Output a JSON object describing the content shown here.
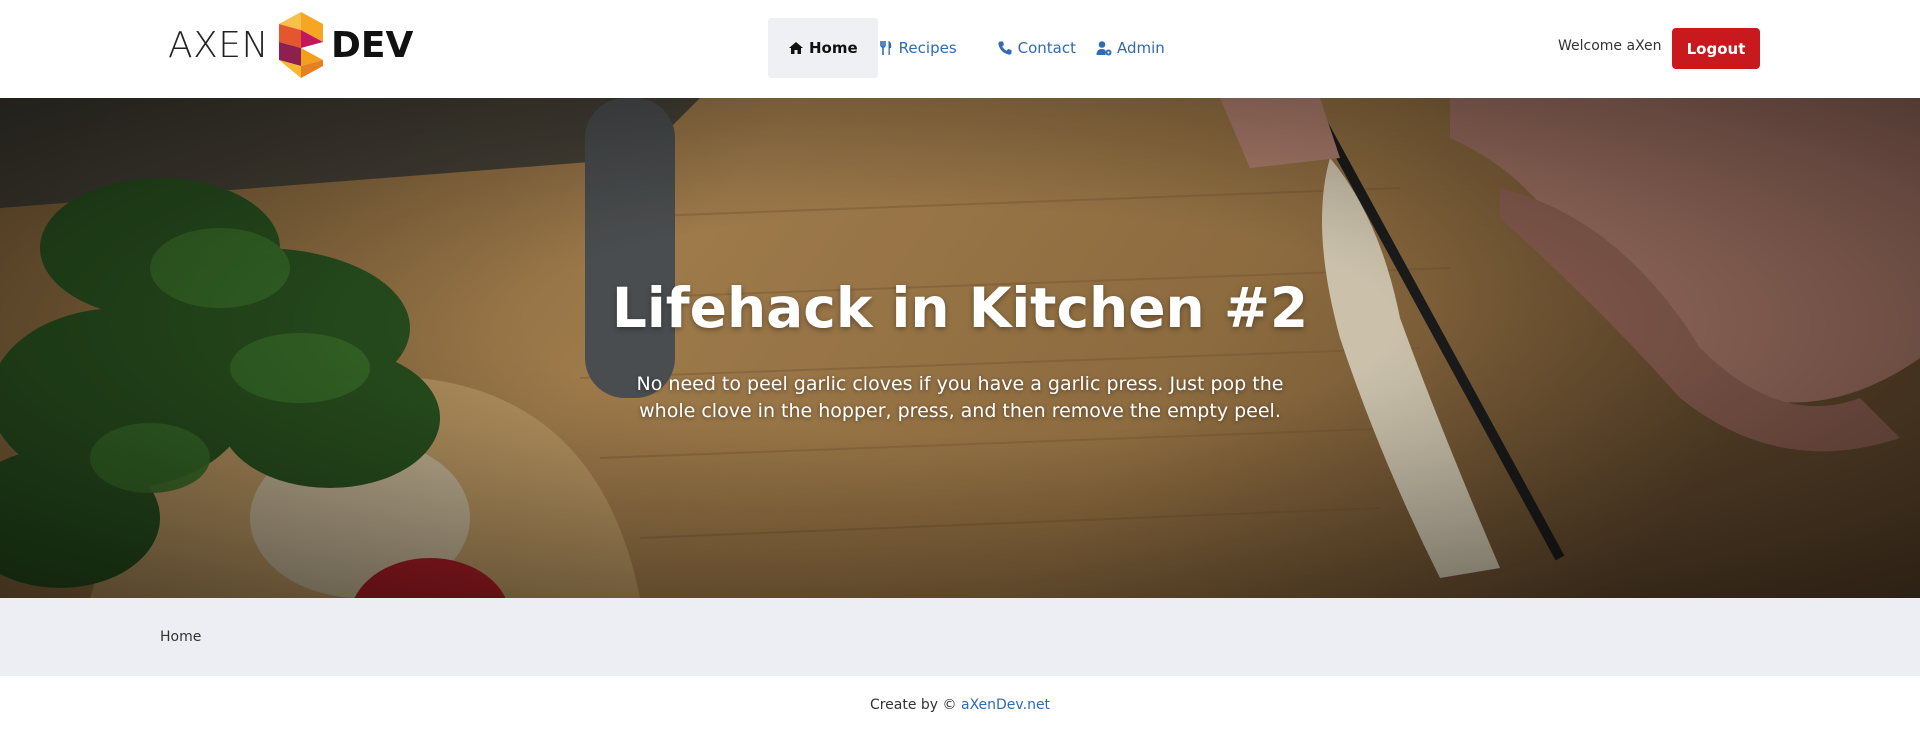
{
  "brand": {
    "left": "AXEN",
    "right": "DEV"
  },
  "nav": {
    "items": [
      {
        "label": "Home",
        "icon": "home-icon",
        "active": true
      },
      {
        "label": "Recipes",
        "icon": "utensils-icon",
        "active": false
      },
      {
        "label": "Contact",
        "icon": "phone-icon",
        "active": false
      },
      {
        "label": "Admin",
        "icon": "user-gear-icon",
        "active": false
      }
    ]
  },
  "user": {
    "welcome": "Welcome aXen",
    "logout_label": "Logout"
  },
  "hero": {
    "title": "Lifehack in Kitchen #2",
    "text": "No need to peel garlic cloves if you have a garlic press. Just pop the whole clove in the hopper, press, and then remove the empty peel."
  },
  "breadcrumb": {
    "current": "Home"
  },
  "footer": {
    "prefix": "Create by ©",
    "link_text": "aXenDev.net"
  },
  "colors": {
    "accent": "#2f6ab3",
    "logout": "#c8191e",
    "band": "#eceef3"
  }
}
